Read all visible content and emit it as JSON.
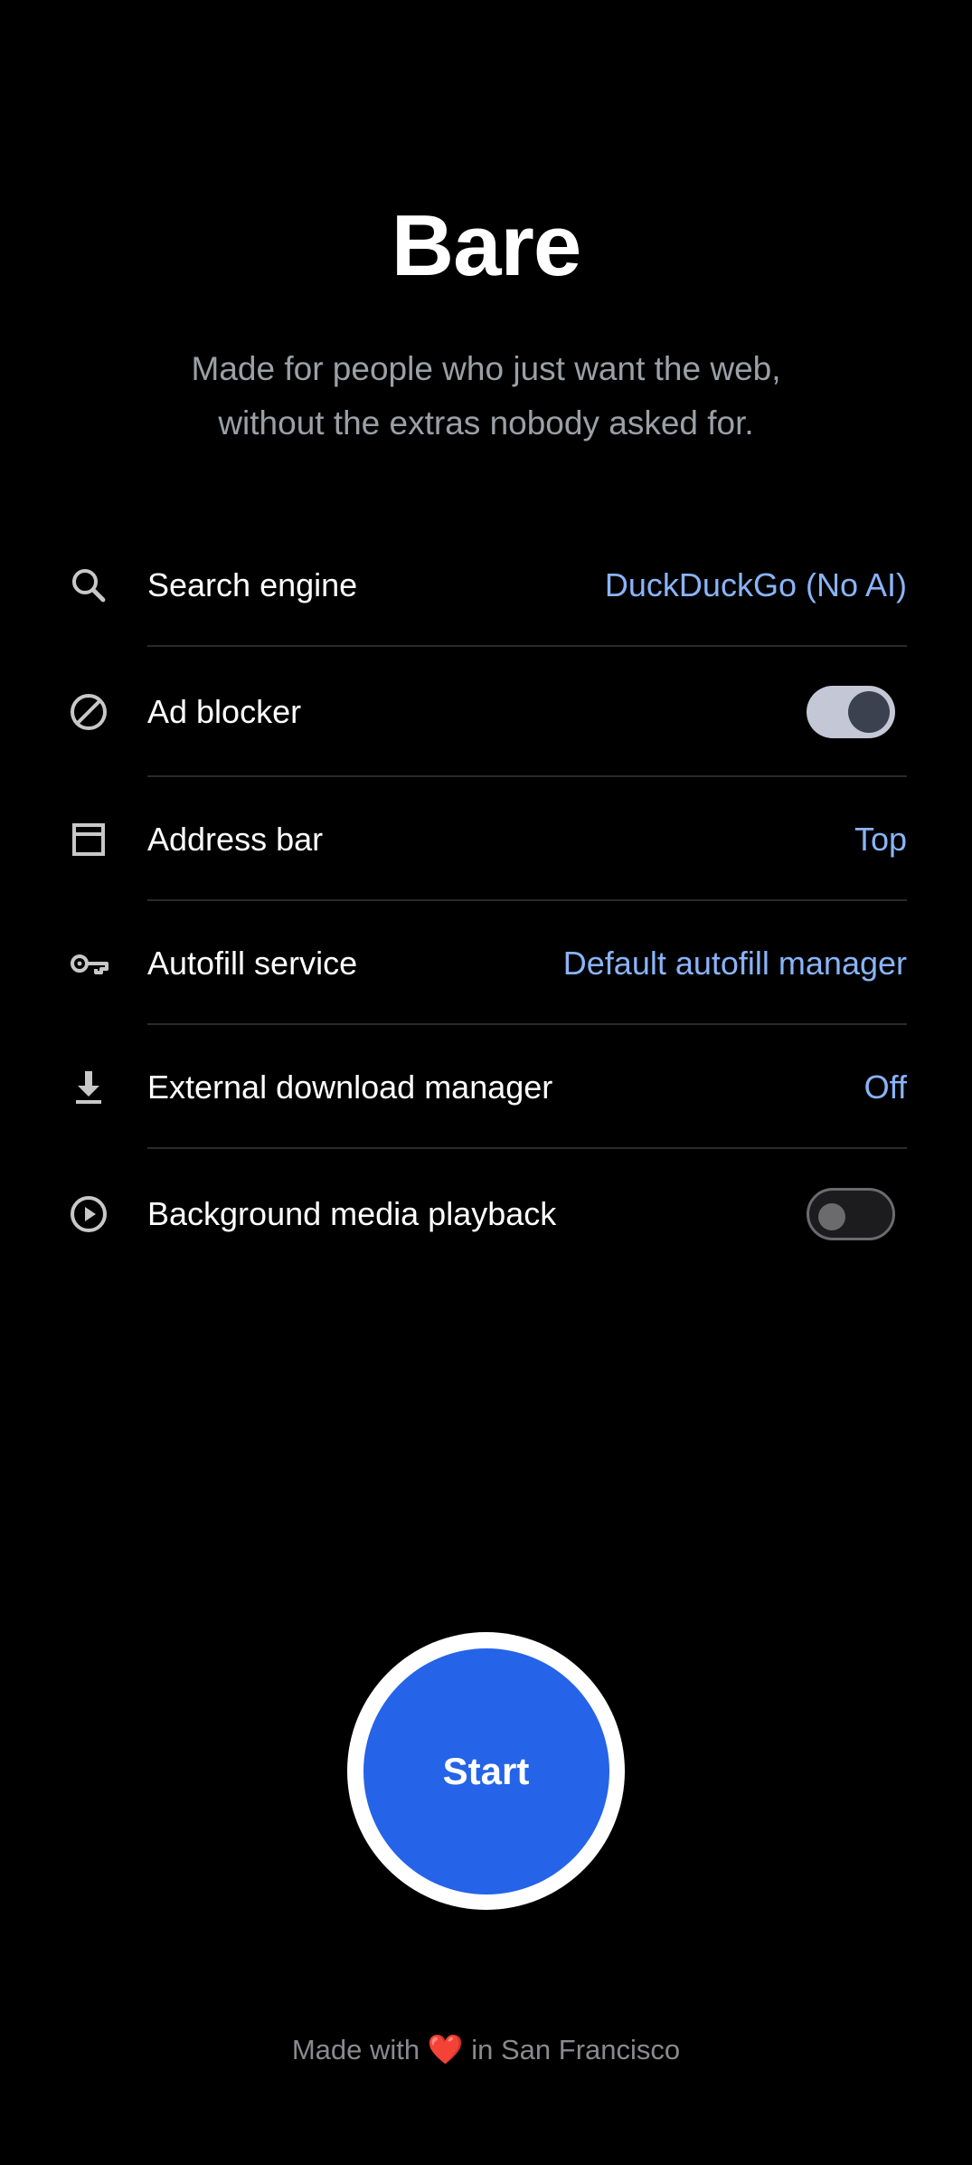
{
  "header": {
    "title": "Bare",
    "tagline_line1": "Made for people who just want the web,",
    "tagline_line2": "without the extras nobody asked for."
  },
  "settings": {
    "search_engine": {
      "label": "Search engine",
      "value": "DuckDuckGo (No AI)",
      "icon": "search-icon"
    },
    "ad_blocker": {
      "label": "Ad blocker",
      "enabled": true,
      "icon": "block-icon"
    },
    "address_bar": {
      "label": "Address bar",
      "value": "Top",
      "icon": "window-icon"
    },
    "autofill": {
      "label": "Autofill service",
      "value": "Default autofill manager",
      "icon": "key-icon"
    },
    "download_manager": {
      "label": "External download manager",
      "value": "Off",
      "icon": "download-icon"
    },
    "background_playback": {
      "label": "Background media playback",
      "enabled": false,
      "icon": "play-circle-icon"
    }
  },
  "start_button": {
    "label": "Start"
  },
  "footer": {
    "prefix": "Made with",
    "heart": "❤️",
    "suffix": "in San Francisco"
  },
  "colors": {
    "background": "#000000",
    "accent_value": "#8ab4f8",
    "start_blue": "#2563e8",
    "muted_text": "#9aa0a6"
  }
}
